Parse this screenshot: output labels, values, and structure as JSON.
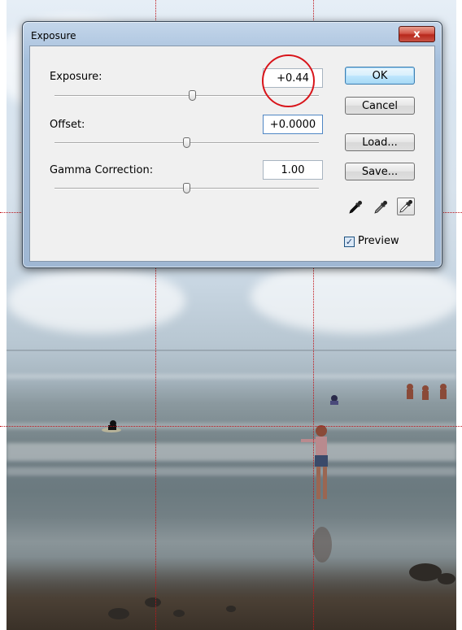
{
  "window": {
    "title": "Exposure",
    "close_label": "x"
  },
  "controls": {
    "exposure": {
      "label": "Exposure:",
      "value": "+0.44",
      "slider_fraction": 0.52
    },
    "offset": {
      "label": "Offset:",
      "value": "+0.0000",
      "slider_fraction": 0.5
    },
    "gamma": {
      "label": "Gamma Correction:",
      "value": "1.00",
      "slider_fraction": 0.5
    }
  },
  "buttons": {
    "ok": "OK",
    "cancel": "Cancel",
    "load": "Load...",
    "save": "Save..."
  },
  "preview": {
    "label": "Preview",
    "checked": true,
    "check_glyph": "✓"
  },
  "icons": [
    "eyedropper-black-icon",
    "eyedropper-gray-icon",
    "eyedropper-white-icon"
  ],
  "colors": {
    "guide": "#c0141a",
    "annotation": "#d8141a",
    "default_button": "#3c7fb1"
  }
}
